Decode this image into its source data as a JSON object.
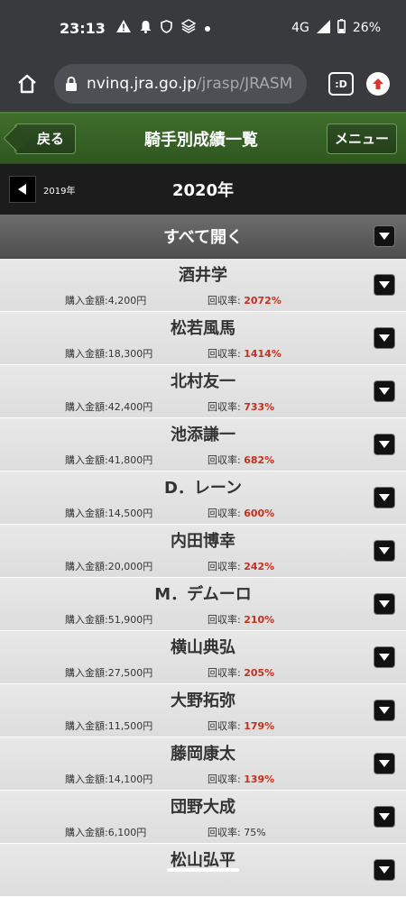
{
  "status": {
    "time": "23:13",
    "network": "4G",
    "battery": "26%"
  },
  "browser": {
    "url_host": "nvinq.jra.go.jp",
    "url_path": "/jrasp/JRASM",
    "tab_label": ":D"
  },
  "header": {
    "back_label": "戻る",
    "title": "騎手別成績一覧",
    "menu_label": "メニュー"
  },
  "year": {
    "prev_label": "2019年",
    "current_label": "2020年"
  },
  "open_all_label": "すべて開く",
  "labels": {
    "purchase": "購入金額:",
    "recovery": "回収率: "
  },
  "colors": {
    "accent_green": "#3f6e2c",
    "rate_red": "#c0321e"
  },
  "jockeys": [
    {
      "name": "酒井学",
      "purchase": "4,200円",
      "recovery": "2072%",
      "highlight": true
    },
    {
      "name": "松若風馬",
      "purchase": "18,300円",
      "recovery": "1414%",
      "highlight": true
    },
    {
      "name": "北村友一",
      "purchase": "42,400円",
      "recovery": "733%",
      "highlight": true
    },
    {
      "name": "池添謙一",
      "purchase": "41,800円",
      "recovery": "682%",
      "highlight": true
    },
    {
      "name": "D．レーン",
      "purchase": "14,500円",
      "recovery": "600%",
      "highlight": true
    },
    {
      "name": "内田博幸",
      "purchase": "20,000円",
      "recovery": "242%",
      "highlight": true
    },
    {
      "name": "M．デムーロ",
      "purchase": "51,900円",
      "recovery": "210%",
      "highlight": true
    },
    {
      "name": "横山典弘",
      "purchase": "27,500円",
      "recovery": "205%",
      "highlight": true
    },
    {
      "name": "大野拓弥",
      "purchase": "11,500円",
      "recovery": "179%",
      "highlight": true
    },
    {
      "name": "藤岡康太",
      "purchase": "14,100円",
      "recovery": "139%",
      "highlight": true
    },
    {
      "name": "団野大成",
      "purchase": "6,100円",
      "recovery": "75%",
      "highlight": false
    },
    {
      "name": "松山弘平",
      "purchase": "",
      "recovery": "",
      "highlight": false
    }
  ]
}
